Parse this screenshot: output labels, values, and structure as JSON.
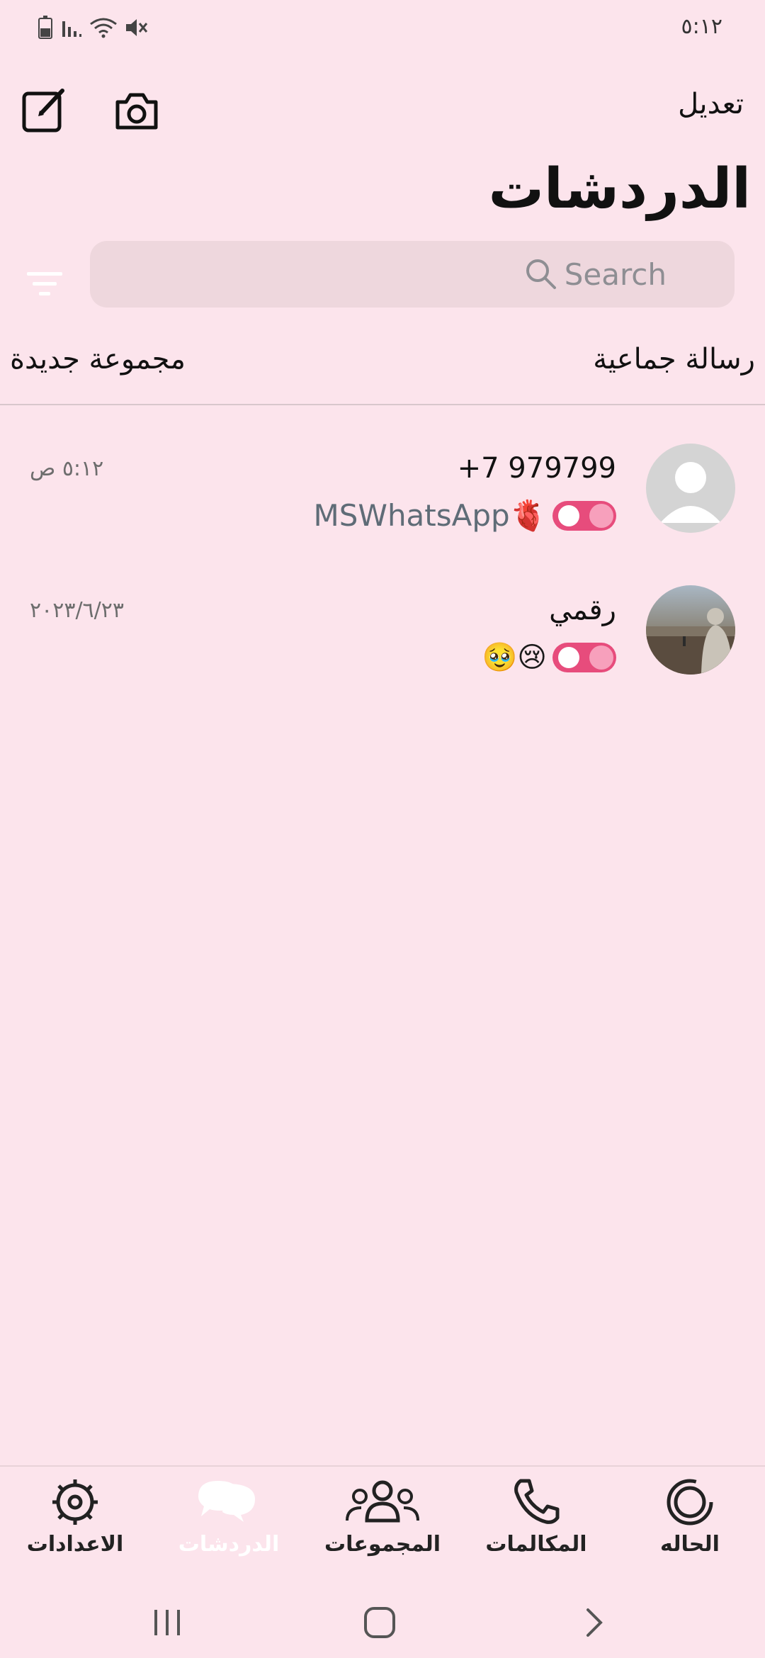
{
  "status_bar": {
    "time": "٥:١٢",
    "icons": [
      "battery-icon",
      "signal-icon",
      "wifi-icon",
      "mute-icon"
    ]
  },
  "header": {
    "edit_label": "تعديل",
    "title": "الدردشات",
    "icons": [
      "compose-icon",
      "camera-icon"
    ]
  },
  "search": {
    "placeholder": "Search",
    "filter_icon": "filter-icon"
  },
  "actions": {
    "broadcast_label": "رسالة جماعية",
    "new_group_label": "مجموعة جديدة"
  },
  "chats": [
    {
      "name": "+7 979799",
      "time": "٥:١٢ ص",
      "preview": "MSWhatsApp🫀",
      "emojis": "",
      "avatar": "default-avatar"
    },
    {
      "name": "رقمي",
      "time": "٢٠٢٣/٦/٢٣",
      "preview": "",
      "emojis": "🥹😢",
      "avatar": "photo-avatar"
    }
  ],
  "bottom_nav": {
    "items": [
      {
        "label": "الحاله",
        "icon": "status-icon"
      },
      {
        "label": "المكالمات",
        "icon": "phone-icon"
      },
      {
        "label": "المجموعات",
        "icon": "groups-icon"
      },
      {
        "label": "الدردشات",
        "icon": "chats-icon",
        "active": true
      },
      {
        "label": "الاعدادات",
        "icon": "settings-icon"
      }
    ]
  },
  "colors": {
    "background": "#fce4ec",
    "search_bg": "#eed7dd",
    "toggle_accent": "#e74c7c",
    "active_nav": "#ffffff"
  }
}
